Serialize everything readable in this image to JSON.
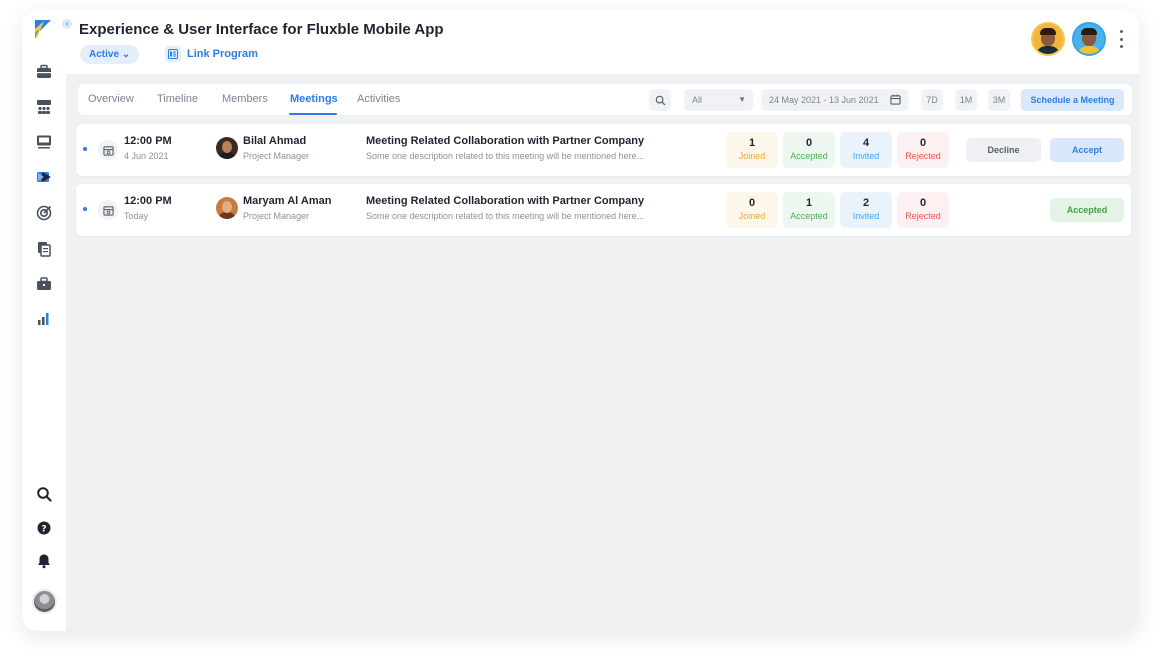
{
  "app": {
    "brand_colors": {
      "accent": "#2e7ce6",
      "logo_blue": "#2e7ce6",
      "logo_yellow": "#f2c94c"
    }
  },
  "sidebar": {
    "top_icons": [
      "briefcase-icon",
      "team-icon",
      "board-icon",
      "campaign-icon",
      "target-icon",
      "documents-icon",
      "toolbox-icon",
      "analytics-icon"
    ],
    "bottom_icons": [
      "search-icon",
      "help-icon",
      "bell-icon"
    ],
    "active_icon": "campaign-icon"
  },
  "header": {
    "title": "Experience & User Interface for Fluxble Mobile App",
    "status": "Active ⌄",
    "link_program": "Link Program"
  },
  "tabs": [
    {
      "label": "Overview",
      "active": false
    },
    {
      "label": "Timeline",
      "active": false
    },
    {
      "label": "Members",
      "active": false
    },
    {
      "label": "Meetings",
      "active": true
    },
    {
      "label": "Activities",
      "active": false
    }
  ],
  "toolbar": {
    "filter_value": "All",
    "date_range": "24 May 2021 - 13 Jun 2021",
    "ranges": [
      "7D",
      "1M",
      "3M"
    ],
    "schedule_button": "Schedule a Meeting"
  },
  "stat_labels": {
    "joined": "Joined",
    "accepted": "Accepted",
    "invited": "Invited",
    "rejected": "Rejected"
  },
  "meetings": [
    {
      "time": "12:00 PM",
      "date": "4 Jun 2021",
      "person": "Bilal Ahmad",
      "role": "Project Manager",
      "title": "Meeting Related Collaboration with Partner Company",
      "description": "Some one description related to this meeting will be mentioned here...",
      "joined": "1",
      "accepted": "0",
      "invited": "4",
      "rejected": "0",
      "decline_label": "Decline",
      "accept_label": "Accept"
    },
    {
      "time": "12:00 PM",
      "date": "Today",
      "person": "Maryam Al Aman",
      "role": "Project Manager",
      "title": "Meeting Related Collaboration with Partner Company",
      "description": "Some one description related to this meeting will be mentioned here...",
      "joined": "0",
      "accepted": "1",
      "invited": "2",
      "rejected": "0",
      "status_label": "Accepted"
    }
  ]
}
